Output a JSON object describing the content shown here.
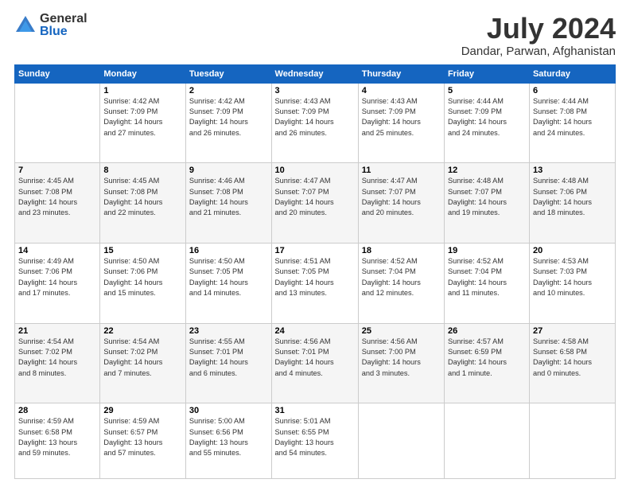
{
  "logo": {
    "general": "General",
    "blue": "Blue"
  },
  "title": "July 2024",
  "location": "Dandar, Parwan, Afghanistan",
  "days_header": [
    "Sunday",
    "Monday",
    "Tuesday",
    "Wednesday",
    "Thursday",
    "Friday",
    "Saturday"
  ],
  "weeks": [
    [
      {
        "day": "",
        "info": ""
      },
      {
        "day": "1",
        "info": "Sunrise: 4:42 AM\nSunset: 7:09 PM\nDaylight: 14 hours\nand 27 minutes."
      },
      {
        "day": "2",
        "info": "Sunrise: 4:42 AM\nSunset: 7:09 PM\nDaylight: 14 hours\nand 26 minutes."
      },
      {
        "day": "3",
        "info": "Sunrise: 4:43 AM\nSunset: 7:09 PM\nDaylight: 14 hours\nand 26 minutes."
      },
      {
        "day": "4",
        "info": "Sunrise: 4:43 AM\nSunset: 7:09 PM\nDaylight: 14 hours\nand 25 minutes."
      },
      {
        "day": "5",
        "info": "Sunrise: 4:44 AM\nSunset: 7:09 PM\nDaylight: 14 hours\nand 24 minutes."
      },
      {
        "day": "6",
        "info": "Sunrise: 4:44 AM\nSunset: 7:08 PM\nDaylight: 14 hours\nand 24 minutes."
      }
    ],
    [
      {
        "day": "7",
        "info": "Sunrise: 4:45 AM\nSunset: 7:08 PM\nDaylight: 14 hours\nand 23 minutes."
      },
      {
        "day": "8",
        "info": "Sunrise: 4:45 AM\nSunset: 7:08 PM\nDaylight: 14 hours\nand 22 minutes."
      },
      {
        "day": "9",
        "info": "Sunrise: 4:46 AM\nSunset: 7:08 PM\nDaylight: 14 hours\nand 21 minutes."
      },
      {
        "day": "10",
        "info": "Sunrise: 4:47 AM\nSunset: 7:07 PM\nDaylight: 14 hours\nand 20 minutes."
      },
      {
        "day": "11",
        "info": "Sunrise: 4:47 AM\nSunset: 7:07 PM\nDaylight: 14 hours\nand 20 minutes."
      },
      {
        "day": "12",
        "info": "Sunrise: 4:48 AM\nSunset: 7:07 PM\nDaylight: 14 hours\nand 19 minutes."
      },
      {
        "day": "13",
        "info": "Sunrise: 4:48 AM\nSunset: 7:06 PM\nDaylight: 14 hours\nand 18 minutes."
      }
    ],
    [
      {
        "day": "14",
        "info": "Sunrise: 4:49 AM\nSunset: 7:06 PM\nDaylight: 14 hours\nand 17 minutes."
      },
      {
        "day": "15",
        "info": "Sunrise: 4:50 AM\nSunset: 7:06 PM\nDaylight: 14 hours\nand 15 minutes."
      },
      {
        "day": "16",
        "info": "Sunrise: 4:50 AM\nSunset: 7:05 PM\nDaylight: 14 hours\nand 14 minutes."
      },
      {
        "day": "17",
        "info": "Sunrise: 4:51 AM\nSunset: 7:05 PM\nDaylight: 14 hours\nand 13 minutes."
      },
      {
        "day": "18",
        "info": "Sunrise: 4:52 AM\nSunset: 7:04 PM\nDaylight: 14 hours\nand 12 minutes."
      },
      {
        "day": "19",
        "info": "Sunrise: 4:52 AM\nSunset: 7:04 PM\nDaylight: 14 hours\nand 11 minutes."
      },
      {
        "day": "20",
        "info": "Sunrise: 4:53 AM\nSunset: 7:03 PM\nDaylight: 14 hours\nand 10 minutes."
      }
    ],
    [
      {
        "day": "21",
        "info": "Sunrise: 4:54 AM\nSunset: 7:02 PM\nDaylight: 14 hours\nand 8 minutes."
      },
      {
        "day": "22",
        "info": "Sunrise: 4:54 AM\nSunset: 7:02 PM\nDaylight: 14 hours\nand 7 minutes."
      },
      {
        "day": "23",
        "info": "Sunrise: 4:55 AM\nSunset: 7:01 PM\nDaylight: 14 hours\nand 6 minutes."
      },
      {
        "day": "24",
        "info": "Sunrise: 4:56 AM\nSunset: 7:01 PM\nDaylight: 14 hours\nand 4 minutes."
      },
      {
        "day": "25",
        "info": "Sunrise: 4:56 AM\nSunset: 7:00 PM\nDaylight: 14 hours\nand 3 minutes."
      },
      {
        "day": "26",
        "info": "Sunrise: 4:57 AM\nSunset: 6:59 PM\nDaylight: 14 hours\nand 1 minute."
      },
      {
        "day": "27",
        "info": "Sunrise: 4:58 AM\nSunset: 6:58 PM\nDaylight: 14 hours\nand 0 minutes."
      }
    ],
    [
      {
        "day": "28",
        "info": "Sunrise: 4:59 AM\nSunset: 6:58 PM\nDaylight: 13 hours\nand 59 minutes."
      },
      {
        "day": "29",
        "info": "Sunrise: 4:59 AM\nSunset: 6:57 PM\nDaylight: 13 hours\nand 57 minutes."
      },
      {
        "day": "30",
        "info": "Sunrise: 5:00 AM\nSunset: 6:56 PM\nDaylight: 13 hours\nand 55 minutes."
      },
      {
        "day": "31",
        "info": "Sunrise: 5:01 AM\nSunset: 6:55 PM\nDaylight: 13 hours\nand 54 minutes."
      },
      {
        "day": "",
        "info": ""
      },
      {
        "day": "",
        "info": ""
      },
      {
        "day": "",
        "info": ""
      }
    ]
  ]
}
